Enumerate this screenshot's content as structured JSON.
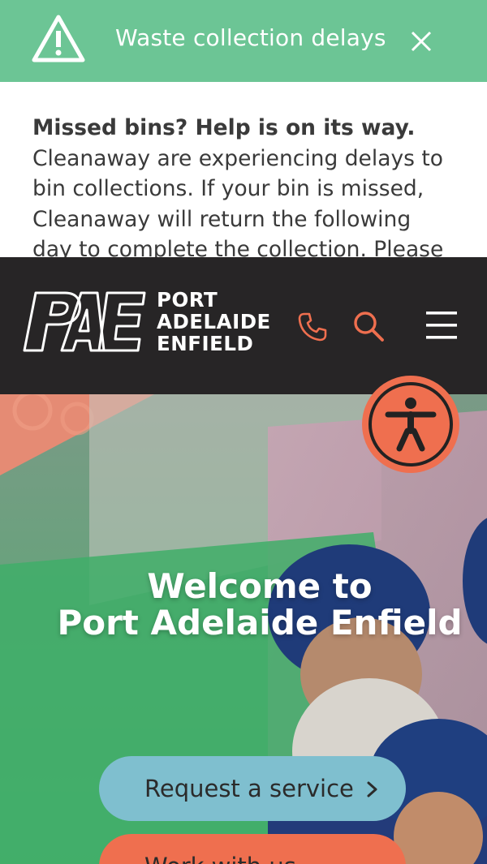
{
  "alert": {
    "title": "Waste collection delays",
    "heading": "Missed bins? Help is on its way.",
    "body_lines": [
      "Cleanaway are experiencing delays to",
      "bin collections. If your bin is missed,",
      "Cleanaway will return the following",
      "day to complete the collection. Please"
    ],
    "icons": {
      "warning": "warning-triangle-icon",
      "close": "close-icon"
    }
  },
  "header": {
    "logo_lines": [
      "PORT",
      "ADELAIDE",
      "ENFIELD"
    ],
    "icons": [
      "phone-icon",
      "search-icon",
      "hamburger-menu-icon"
    ]
  },
  "hero": {
    "title_line1": "Welcome to",
    "title_line2": "Port Adelaide Enfield",
    "buttons": [
      {
        "label": "Request a service"
      },
      {
        "label": "Work with us"
      }
    ]
  },
  "accessibility_button": {
    "icon": "accessibility-person-icon"
  },
  "colors": {
    "alert_green": "#6cc595",
    "header_dark": "#272526",
    "accent_orange": "#ef6f4f",
    "button_blue": "#7fbfcf",
    "text_dark": "#3a3a3a"
  }
}
